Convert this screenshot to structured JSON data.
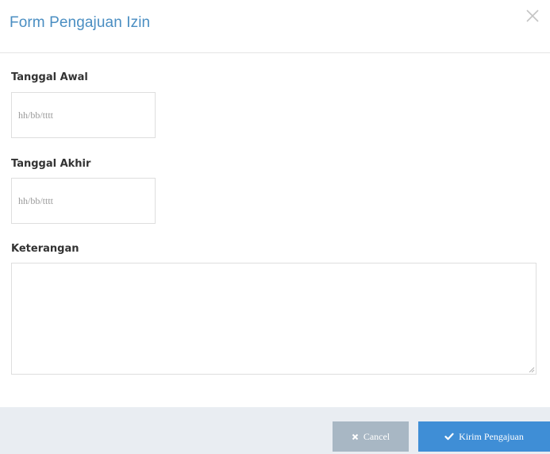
{
  "modal": {
    "title": "Form Pengajuan Izin"
  },
  "form": {
    "start_date": {
      "label": "Tanggal Awal",
      "placeholder": "hh/bb/tttt"
    },
    "end_date": {
      "label": "Tanggal Akhir",
      "placeholder": "hh/bb/tttt"
    },
    "notes": {
      "label": "Keterangan",
      "value": ""
    }
  },
  "footer": {
    "cancel_label": "Cancel",
    "submit_label": "Kirim Pengajuan"
  },
  "colors": {
    "title": "#4a8ec2",
    "cancel_bg": "#a8b7c4",
    "submit_bg": "#3f8ed6",
    "footer_bg": "#e9edf2"
  },
  "icons": {
    "close": "close-icon",
    "cancel": "x-icon",
    "submit": "check-icon"
  }
}
